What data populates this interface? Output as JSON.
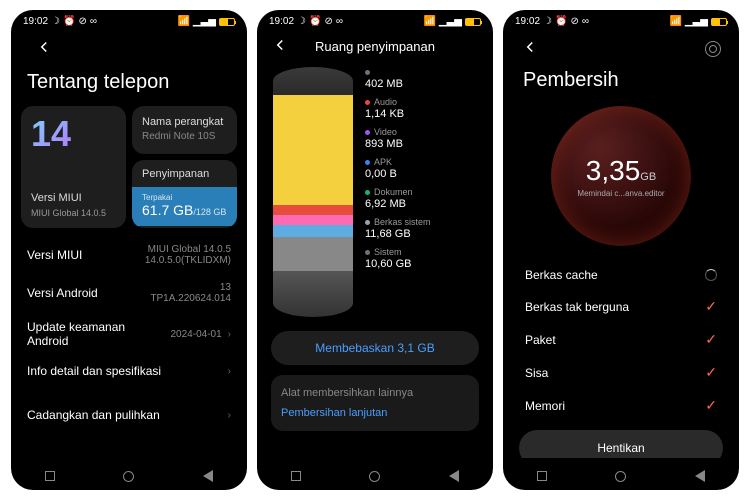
{
  "status": {
    "time": "19:02"
  },
  "s1": {
    "title": "Tentang telepon",
    "miui_label": "Versi MIUI",
    "miui_val": "MIUI Global 14.0.5",
    "device_label": "Nama perangkat",
    "device_val": "Redmi Note 10S",
    "storage_label": "Penyimpanan",
    "storage_used_label": "Terpakai",
    "storage_used": "61.7 GB",
    "storage_total": "/128 GB",
    "rows": [
      {
        "l": "Versi MIUI",
        "r1": "MIUI Global 14.0.5",
        "r2": "14.0.5.0(TKLIDXM)"
      },
      {
        "l": "Versi Android",
        "r1": "13",
        "r2": "TP1A.220624.014"
      },
      {
        "l": "Update keamanan Android",
        "r1": "2024-04-01",
        "r2": ""
      }
    ],
    "detail": "Info detail dan spesifikasi",
    "backup": "Cadangkan dan pulihkan"
  },
  "s2": {
    "title": "Ruang penyimpanan",
    "items": [
      {
        "color": "#6b7280",
        "label": "",
        "val": "402 MB"
      },
      {
        "color": "#ef4444",
        "label": "Audio",
        "val": "1,14 KB"
      },
      {
        "color": "#a855f7",
        "label": "Video",
        "val": "893 MB"
      },
      {
        "color": "#3b82f6",
        "label": "APK",
        "val": "0,00 B"
      },
      {
        "color": "#10b981",
        "label": "Dokumen",
        "val": "6,92 MB"
      },
      {
        "color": "#9ca3af",
        "label": "Berkas sistem",
        "val": "11,68 GB"
      },
      {
        "color": "#6b7280",
        "label": "Sistem",
        "val": "10,60 GB"
      }
    ],
    "free_btn": "Membebaskan 3,1 GB",
    "other_title": "Alat membersihkan lainnya",
    "advanced": "Pembersihan lanjutan"
  },
  "s3": {
    "title": "Pembersih",
    "size": "3,35",
    "unit": "GB",
    "scanning": "Memindai c...anva.editor",
    "rows": [
      {
        "l": "Berkas cache",
        "state": "spin"
      },
      {
        "l": "Berkas tak berguna",
        "state": "done"
      },
      {
        "l": "Paket",
        "state": "done"
      },
      {
        "l": "Sisa",
        "state": "done"
      },
      {
        "l": "Memori",
        "state": "done"
      }
    ],
    "stop": "Hentikan"
  }
}
